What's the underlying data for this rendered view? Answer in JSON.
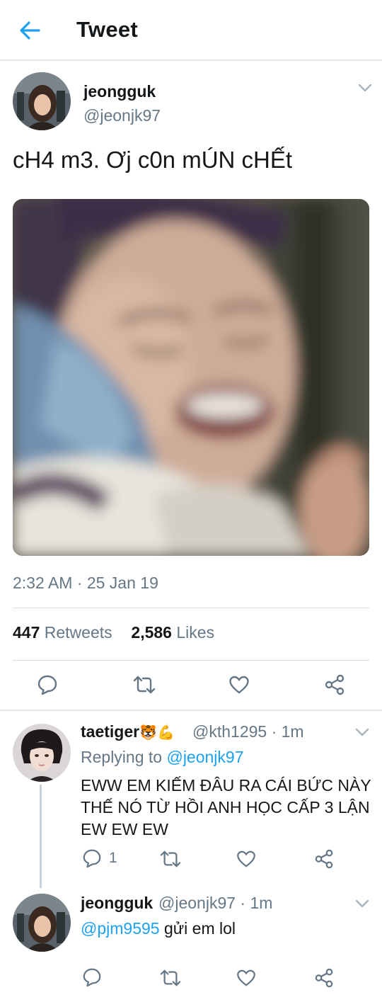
{
  "header": {
    "title": "Tweet"
  },
  "tweet": {
    "name": "jeongguk",
    "handle": "@jeonjk97",
    "text": "cH4 m3. Ơj c0n mÚN cHẾt",
    "timestamp": "2:32 AM · 25 Jan 19",
    "retweets_count": "447",
    "retweets_label": "Retweets",
    "likes_count": "2,586",
    "likes_label": "Likes"
  },
  "replies": [
    {
      "name": "taetiger",
      "name_emojis": "🐯💪",
      "handle": "@kth1295",
      "time": "· 1m",
      "replying_prefix": "Replying to",
      "replying_to": "@jeonjk97",
      "text": "EWW EM KIẾM ĐÂU RA CÁI BỨC NÀY THẾ NÓ TỪ HỒI ANH HỌC CẤP 3 LẬN EW EW EW",
      "reply_count": "1"
    },
    {
      "name": "jeongguk",
      "handle": "@jeonjk97",
      "time": "· 1m",
      "mention": "@pjm9595",
      "text": " gửi em lol"
    }
  ],
  "colors": {
    "accent": "#1da1f2",
    "secondary_text": "#657786",
    "divider": "#e1e8ed"
  },
  "icons": [
    "back-arrow-icon",
    "chevron-down-icon",
    "reply-icon",
    "retweet-icon",
    "like-icon",
    "share-icon"
  ]
}
